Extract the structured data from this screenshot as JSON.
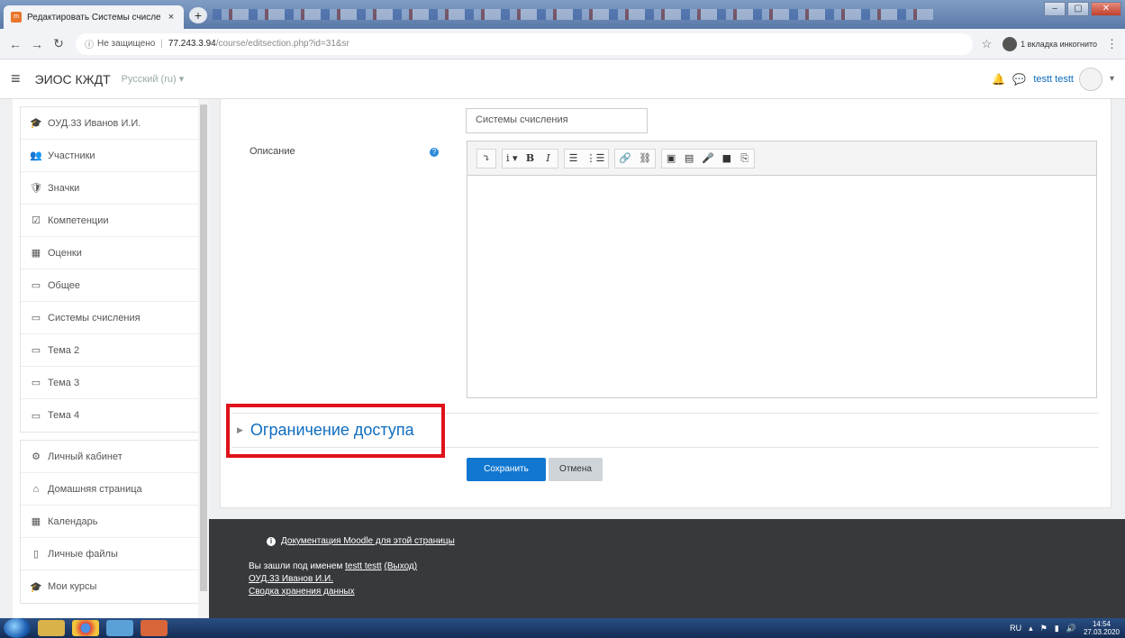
{
  "browser": {
    "tab_title": "Редактировать Системы счисле",
    "tab_favicon": "m",
    "new_tab": "+",
    "not_secure": "Не защищено",
    "url_host": "77.243.3.94",
    "url_path": "/course/editsection.php?id=31&sr",
    "incognito": "1 вкладка инкогнито"
  },
  "navbar": {
    "brand": "ЭИОС КЖДТ",
    "language": "Русский (ru) ▾",
    "username": "testt testt"
  },
  "sidebar": {
    "course_items": [
      {
        "icon": "graduation-cap-icon",
        "glyph": "🎓",
        "label": "ОУД.33 Иванов И.И."
      },
      {
        "icon": "users-icon",
        "glyph": "👥",
        "label": "Участники"
      },
      {
        "icon": "shield-icon",
        "glyph": "🛡",
        "label": "Значки"
      },
      {
        "icon": "checkbox-icon",
        "glyph": "☑",
        "label": "Компетенции"
      },
      {
        "icon": "table-icon",
        "glyph": "▦",
        "label": "Оценки"
      },
      {
        "icon": "folder-icon",
        "glyph": "▭",
        "label": "Общее"
      },
      {
        "icon": "folder-icon",
        "glyph": "▭",
        "label": "Системы счисления"
      },
      {
        "icon": "folder-icon",
        "glyph": "▭",
        "label": "Тема 2"
      },
      {
        "icon": "folder-icon",
        "glyph": "▭",
        "label": "Тема 3"
      },
      {
        "icon": "folder-icon",
        "glyph": "▭",
        "label": "Тема 4"
      }
    ],
    "site_items": [
      {
        "icon": "dashboard-icon",
        "glyph": "⚙",
        "label": "Личный кабинет"
      },
      {
        "icon": "home-icon",
        "glyph": "⌂",
        "label": "Домашняя страница"
      },
      {
        "icon": "calendar-icon",
        "glyph": "▦",
        "label": "Календарь"
      },
      {
        "icon": "file-icon",
        "glyph": "▯",
        "label": "Личные файлы"
      },
      {
        "icon": "graduation-cap-icon",
        "glyph": "🎓",
        "label": "Мои курсы"
      }
    ]
  },
  "form": {
    "section_name_value": "Системы счисления",
    "description_label": "Описание",
    "restrict_access": "Ограничение доступа",
    "save": "Сохранить",
    "cancel": "Отмена"
  },
  "editor_toolbar": [
    [
      "⤵"
    ],
    [
      "i ▾",
      "B",
      "I"
    ],
    [
      "☰",
      "⋮☰"
    ],
    [
      "🔗",
      "⛓"
    ],
    [
      "▣",
      "▤",
      "🎤",
      "■",
      "⎘"
    ]
  ],
  "footer": {
    "docs_link": "Документация Moodle для этой страницы",
    "logged_in_prefix": "Вы зашли под именем",
    "logged_in_user": "testt testt",
    "logout": "(Выход)",
    "course_link": "ОУД.33 Иванов И.И.",
    "data_retention": "Сводка хранения данных"
  },
  "taskbar": {
    "lang": "RU",
    "time": "14:54",
    "date": "27.03.2020"
  }
}
